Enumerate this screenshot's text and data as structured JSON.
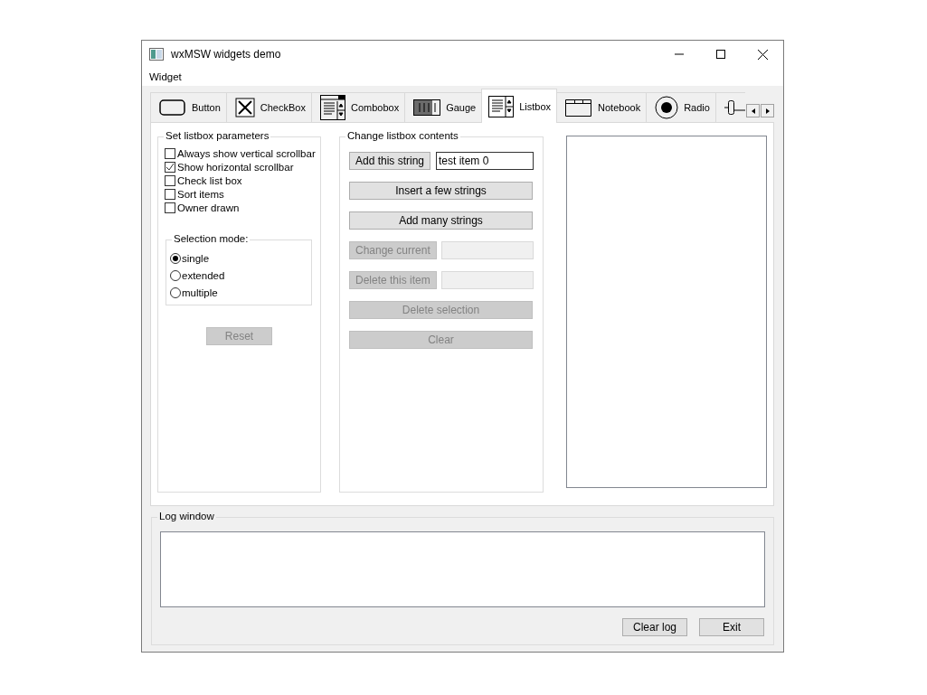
{
  "window": {
    "title": "wxMSW widgets demo"
  },
  "menu": [
    {
      "label": "Widget"
    }
  ],
  "tabs": [
    {
      "label": "Button",
      "selected": false
    },
    {
      "label": "CheckBox",
      "selected": false
    },
    {
      "label": "Combobox",
      "selected": false
    },
    {
      "label": "Gauge",
      "selected": false
    },
    {
      "label": "Listbox",
      "selected": true
    },
    {
      "label": "Notebook",
      "selected": false
    },
    {
      "label": "Radio",
      "selected": false
    },
    {
      "selected": false
    }
  ],
  "params": {
    "title": "Set listbox parameters",
    "checkboxes": [
      {
        "label": "Always show vertical scrollbar",
        "checked": false
      },
      {
        "label": "Show horizontal scrollbar",
        "checked": true
      },
      {
        "label": "Check list box",
        "checked": false
      },
      {
        "label": "Sort items",
        "checked": false
      },
      {
        "label": "Owner drawn",
        "checked": false
      }
    ],
    "selection": {
      "title": "Selection mode:",
      "options": [
        {
          "label": "single",
          "selected": true
        },
        {
          "label": "extended",
          "selected": false
        },
        {
          "label": "multiple",
          "selected": false
        }
      ]
    },
    "reset": {
      "label": "Reset",
      "disabled": true
    }
  },
  "contents": {
    "title": "Change listbox contents",
    "rows": [
      {
        "kind": "button-field",
        "button": {
          "label": "Add this string",
          "disabled": false
        },
        "field": {
          "value": "test item 0",
          "disabled": false
        }
      },
      {
        "kind": "button",
        "button": {
          "label": "Insert a few strings",
          "disabled": false
        }
      },
      {
        "kind": "button",
        "button": {
          "label": "Add many strings",
          "disabled": false
        }
      },
      {
        "kind": "button-field",
        "button": {
          "label": "Change current",
          "disabled": true
        },
        "field": {
          "disabled": true
        }
      },
      {
        "kind": "button-field",
        "button": {
          "label": "Delete this item",
          "disabled": true
        },
        "field": {
          "disabled": true
        }
      },
      {
        "kind": "button",
        "button": {
          "label": "Delete selection",
          "disabled": true
        }
      },
      {
        "kind": "button",
        "button": {
          "label": "Clear",
          "disabled": true
        }
      }
    ]
  },
  "log": {
    "title": "Log window",
    "buttons": [
      {
        "label": "Clear log"
      },
      {
        "label": "Exit"
      }
    ]
  }
}
